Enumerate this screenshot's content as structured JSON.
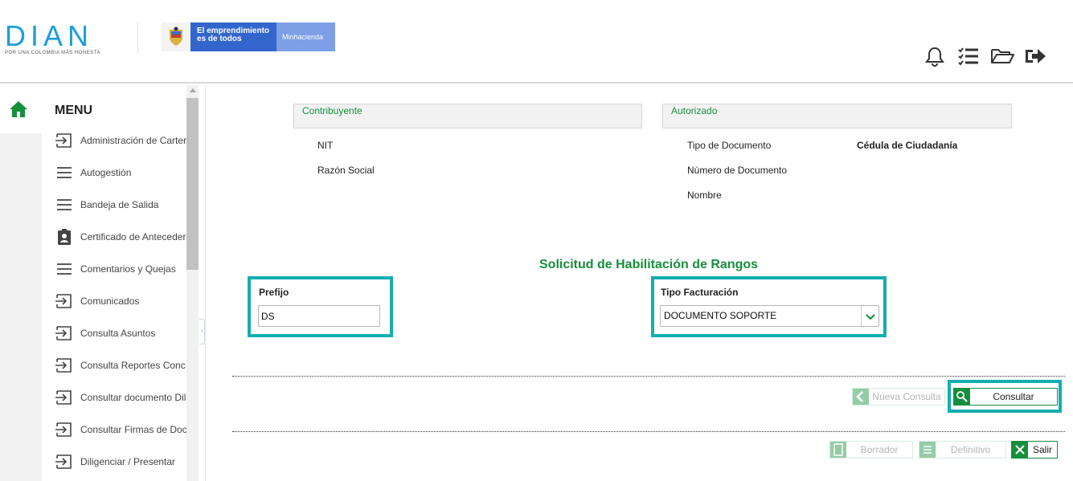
{
  "header": {
    "logo_text": "DIAN",
    "logo_tagline": "POR UNA COLOMBIA MÁS HONESTA",
    "gov_banner": {
      "line1": "El emprendimiento",
      "line2": "es de todos",
      "ministry": "Minhacienda"
    },
    "icons": [
      "bell-icon",
      "checklist-icon",
      "folder-open-icon",
      "sign-out-icon"
    ]
  },
  "sidebar": {
    "title": "MENU",
    "items": [
      {
        "label": "Administración de Carter",
        "icon": "arrow-into-box-icon"
      },
      {
        "label": "Autogestión",
        "icon": "hamburger-icon"
      },
      {
        "label": "Bandeja de Salida",
        "icon": "hamburger-icon"
      },
      {
        "label": "Certificado de Anteceder",
        "icon": "id-badge-icon"
      },
      {
        "label": "Comentarios y Quejas",
        "icon": "hamburger-icon"
      },
      {
        "label": "Comunicados",
        "icon": "arrow-into-box-icon"
      },
      {
        "label": "Consulta Asuntos",
        "icon": "arrow-into-box-icon"
      },
      {
        "label": "Consulta Reportes Conc",
        "icon": "arrow-into-box-icon"
      },
      {
        "label": "Consultar documento Dil",
        "icon": "arrow-into-box-icon"
      },
      {
        "label": "Consultar Firmas de Doc",
        "icon": "arrow-into-box-icon"
      },
      {
        "label": "Diligenciar / Presentar",
        "icon": "arrow-into-box-icon"
      }
    ]
  },
  "contribuyente": {
    "title": "Contribuyente",
    "nit_label": "NIT",
    "razon_label": "Razón Social"
  },
  "autorizado": {
    "title": "Autorizado",
    "tipo_doc_label": "Tipo de Documento",
    "tipo_doc_value": "Cédula de Ciudadanía",
    "numero_doc_label": "Número de Documento",
    "nombre_label": "Nombre"
  },
  "form": {
    "section_title": "Solicitud de Habilitación de Rangos",
    "prefijo_label": "Prefijo",
    "prefijo_value": "DS",
    "tipo_facturacion_label": "Tipo Facturación",
    "tipo_facturacion_value": "DOCUMENTO SOPORTE"
  },
  "buttons": {
    "nueva_consulta": "Nueva Consulta",
    "consultar": "Consultar",
    "borrador": "Borrador",
    "definitivo": "Definitivo",
    "salir": "Salir"
  },
  "colors": {
    "dian_blue": "#1d9ed9",
    "gov_blue": "#3366cc",
    "green": "#168f3d",
    "highlight_teal": "#13aeb0"
  }
}
